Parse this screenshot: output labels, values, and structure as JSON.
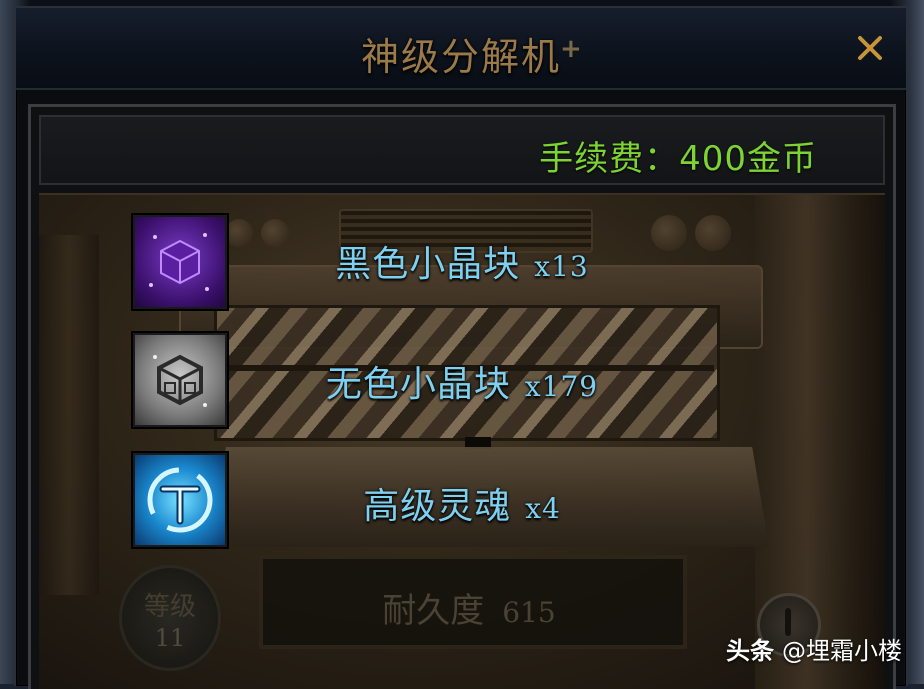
{
  "window": {
    "title": "神级分解机",
    "title_plus": "+"
  },
  "fee": {
    "text": "手续费：400金币"
  },
  "items": [
    {
      "icon": "black-crystal-cube-icon",
      "name": "黑色小晶块",
      "qty": "x13"
    },
    {
      "icon": "colorless-crystal-cube-icon",
      "name": "无色小晶块",
      "qty": "x179"
    },
    {
      "icon": "soul-orb-icon",
      "name": "高级灵魂",
      "qty": "x4"
    }
  ],
  "level": {
    "title": "等级",
    "value": "11"
  },
  "durability": {
    "label": "耐久度",
    "value": "615"
  },
  "watermark": {
    "brand": "头条",
    "author": "@埋霜小楼"
  },
  "colors": {
    "title": "#9a7a48",
    "fee": "#7dd332",
    "item_text": "#7ed0f0",
    "close": "#c8943a"
  }
}
